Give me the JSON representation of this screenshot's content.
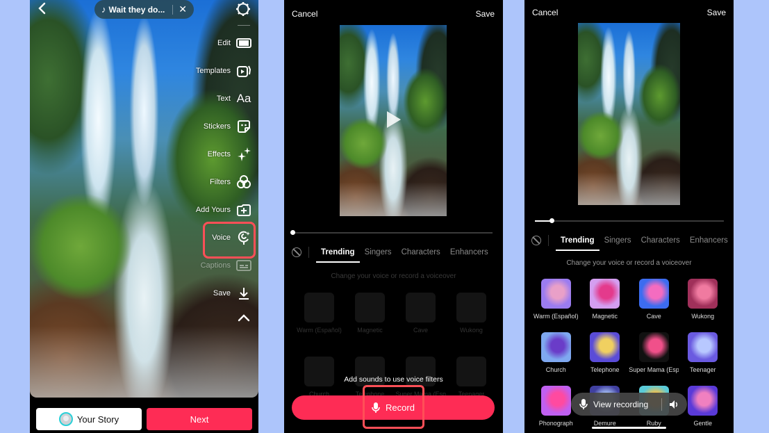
{
  "background_color": "#adc5fb",
  "accent_color": "#fe2c55",
  "highlight_color": "#ff4f57",
  "panel1": {
    "music": {
      "icon": "music-note-icon",
      "title": "Wait they do...",
      "close_icon": "close-icon"
    },
    "tools": [
      {
        "label": "Edit",
        "icon": "edit-clip-icon"
      },
      {
        "label": "Templates",
        "icon": "templates-icon"
      },
      {
        "label": "Text",
        "icon": "text-aa-icon"
      },
      {
        "label": "Stickers",
        "icon": "sticker-icon"
      },
      {
        "label": "Effects",
        "icon": "sparkle-icon"
      },
      {
        "label": "Filters",
        "icon": "filters-icon"
      },
      {
        "label": "Add Yours",
        "icon": "add-yours-icon"
      },
      {
        "label": "Voice",
        "icon": "voice-mic-icon",
        "highlighted": true
      },
      {
        "label": "Captions",
        "icon": "captions-icon",
        "disabled": true
      },
      {
        "label": "Save",
        "icon": "download-icon"
      }
    ],
    "your_story_label": "Your Story",
    "next_label": "Next"
  },
  "panel2": {
    "cancel_label": "Cancel",
    "save_label": "Save",
    "playback_progress": 0,
    "tabs": [
      "Trending",
      "Singers",
      "Characters",
      "Enhancers"
    ],
    "active_tab": "Trending",
    "hint": "Change your voice or record a voiceover",
    "filters": [
      "Warm (Español)",
      "Magnetic",
      "Cave",
      "Wukong",
      "Church",
      "Telephone",
      "Super Mama (Esp",
      "Teenager"
    ],
    "add_sounds_text": "Add sounds to use voice filters",
    "record_label": "Record"
  },
  "panel3": {
    "cancel_label": "Cancel",
    "save_label": "Save",
    "playback_progress": 0.09,
    "tabs": [
      "Trending",
      "Singers",
      "Characters",
      "Enhancers"
    ],
    "active_tab": "Trending",
    "hint": "Change your voice or record a voiceover",
    "filters": [
      {
        "name": "Warm (Español)",
        "colors": [
          "#9b7cf0",
          "#e9a0c8"
        ]
      },
      {
        "name": "Magnetic",
        "colors": [
          "#d49ef0",
          "#e43a8c"
        ]
      },
      {
        "name": "Cave",
        "colors": [
          "#3c6cf0",
          "#f46cc0"
        ]
      },
      {
        "name": "Wukong",
        "colors": [
          "#a0305a",
          "#f07aa0"
        ]
      },
      {
        "name": "Church",
        "colors": [
          "#7fa8f0",
          "#6a3cc8"
        ]
      },
      {
        "name": "Telephone",
        "colors": [
          "#5a4cd8",
          "#f0d060"
        ]
      },
      {
        "name": "Super Mama (Esp",
        "colors": [
          "#111111",
          "#f0508a"
        ]
      },
      {
        "name": "Teenager",
        "colors": [
          "#6a5ae0",
          "#b8c8ff"
        ]
      },
      {
        "name": "Phonograph",
        "colors": [
          "#c060f0",
          "#ff4aa0"
        ]
      },
      {
        "name": "Demure",
        "colors": [
          "#4040a0",
          "#a0b8f0"
        ]
      },
      {
        "name": "Ruby",
        "colors": [
          "#5acbd8",
          "#f0c050"
        ]
      },
      {
        "name": "Gentle",
        "colors": [
          "#5a3ad8",
          "#f080c0"
        ]
      }
    ],
    "view_recording_label": "View recording"
  }
}
